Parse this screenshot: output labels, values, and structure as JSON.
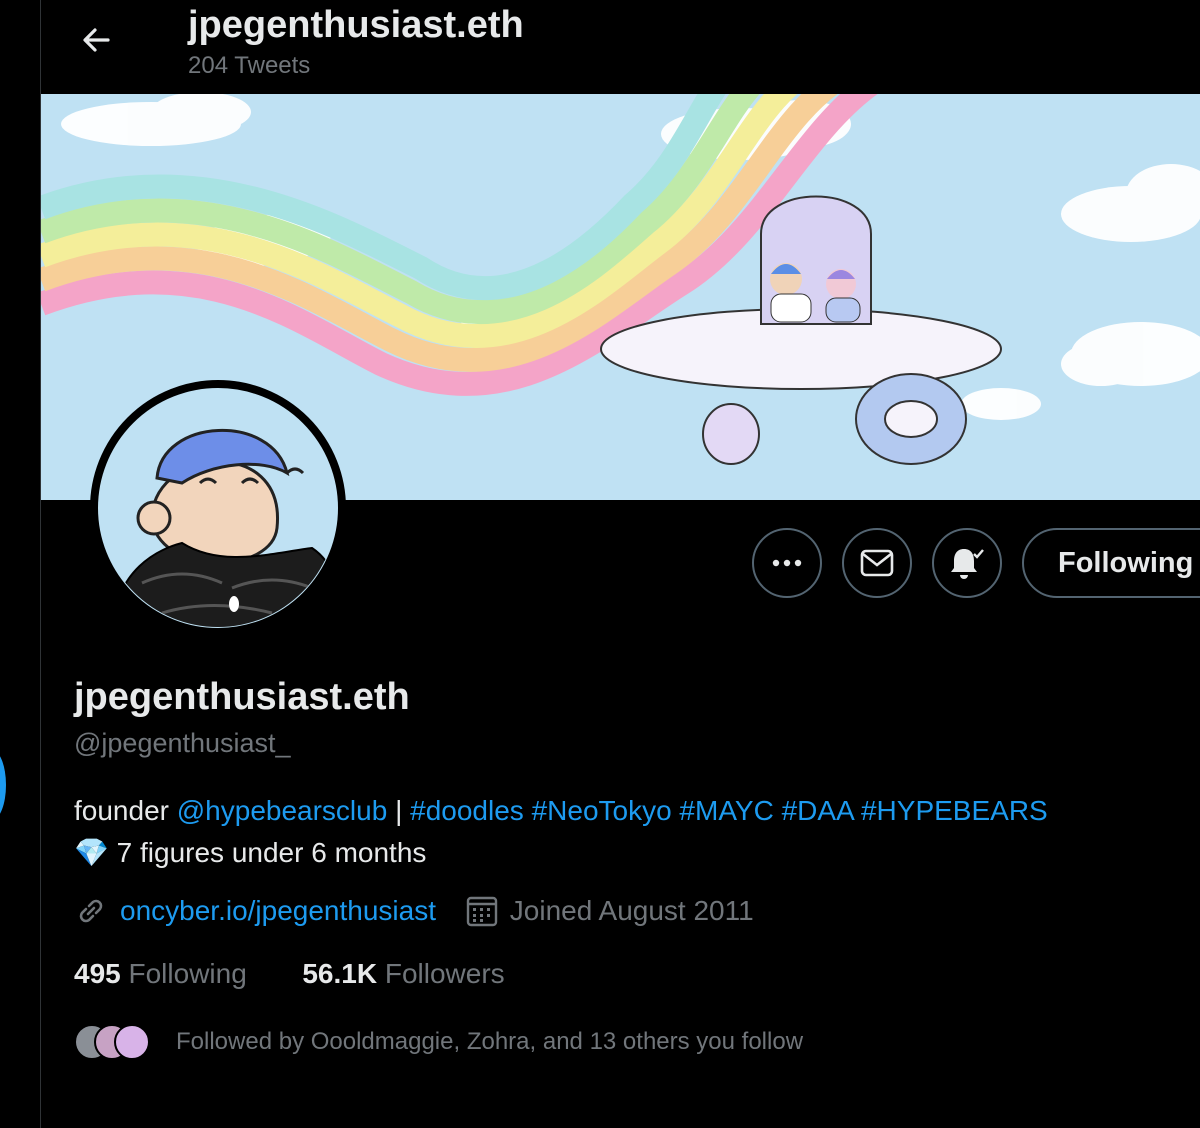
{
  "header": {
    "title": "jpegenthusiast.eth",
    "subtitle": "204 Tweets"
  },
  "profile": {
    "name": "jpegenthusiast.eth",
    "handle": "@jpegenthusiast_",
    "bio_prefix": "founder ",
    "bio_mention": "@hypebearsclub",
    "bio_sep": " | ",
    "bio_tags": "#doodles #NeoTokyo #MAYC #DAA #HYPEBEARS",
    "bio_line2_emoji": "💎",
    "bio_line2": " 7 figures under 6 months",
    "website": "oncyber.io/jpegenthusiast",
    "joined": "Joined August 2011",
    "following_count": "495",
    "following_label": " Following",
    "followers_count": "56.1K",
    "followers_label": " Followers",
    "followed_by": "Followed by Oooldmaggie, Zohra, and 13 others you follow"
  },
  "actions": {
    "follow_label": "Following"
  },
  "icons": {
    "back": "back-arrow-icon",
    "more": "more-icon",
    "message": "envelope-icon",
    "notify": "bell-subscribed-icon",
    "link": "link-icon",
    "calendar": "calendar-icon"
  },
  "colors": {
    "accent": "#1d9bf0",
    "muted": "#71767b",
    "text": "#e7e9ea",
    "border": "#536471"
  }
}
